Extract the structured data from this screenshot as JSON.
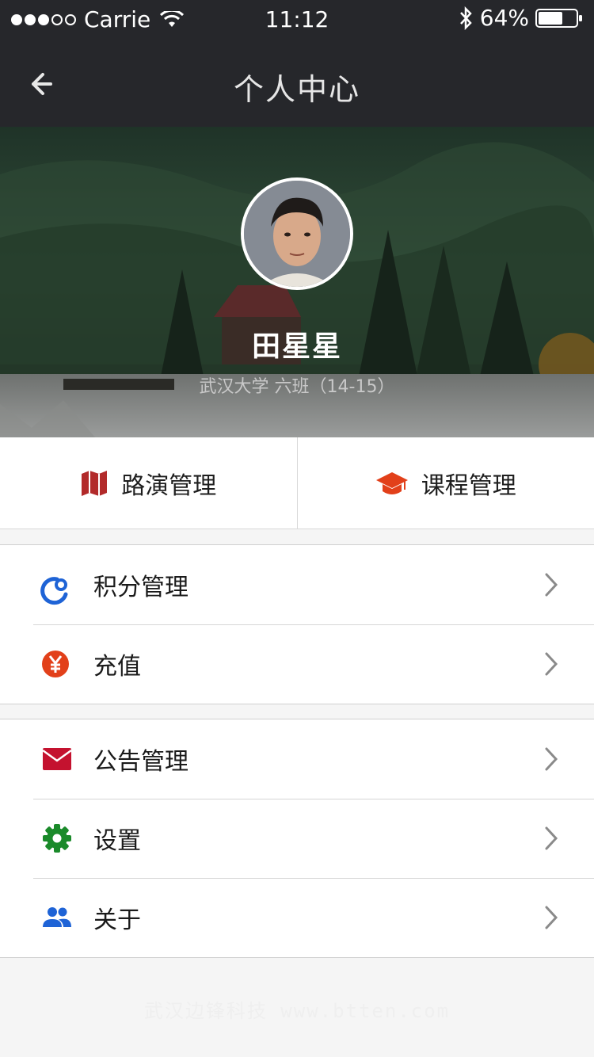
{
  "status_bar": {
    "carrier": "Carrie",
    "time": "11:12",
    "battery": "64%",
    "signal_dots_filled": 3,
    "signal_dots_total": 5
  },
  "nav": {
    "title": "个人中心",
    "back_icon": "arrow-left-icon"
  },
  "profile": {
    "name": "田星星",
    "school": "武汉大学 六班（14-15）"
  },
  "quick_actions": [
    {
      "label": "路演管理",
      "icon": "map-icon",
      "color": "#b22a2a"
    },
    {
      "label": "课程管理",
      "icon": "graduation-cap-icon",
      "color": "#e2401a"
    }
  ],
  "menu_group_1": [
    {
      "label": "积分管理",
      "icon": "points-icon",
      "color": "#1e63d6"
    },
    {
      "label": "充值",
      "icon": "yen-icon",
      "color": "#e2401a"
    }
  ],
  "menu_group_2": [
    {
      "label": "公告管理",
      "icon": "mail-icon",
      "color": "#c4122f"
    },
    {
      "label": "设置",
      "icon": "gear-icon",
      "color": "#1a8a2a"
    },
    {
      "label": "关于",
      "icon": "people-icon",
      "color": "#1e63d6"
    }
  ],
  "footer": {
    "watermark": "武汉边锋科技 www.btten.com"
  }
}
